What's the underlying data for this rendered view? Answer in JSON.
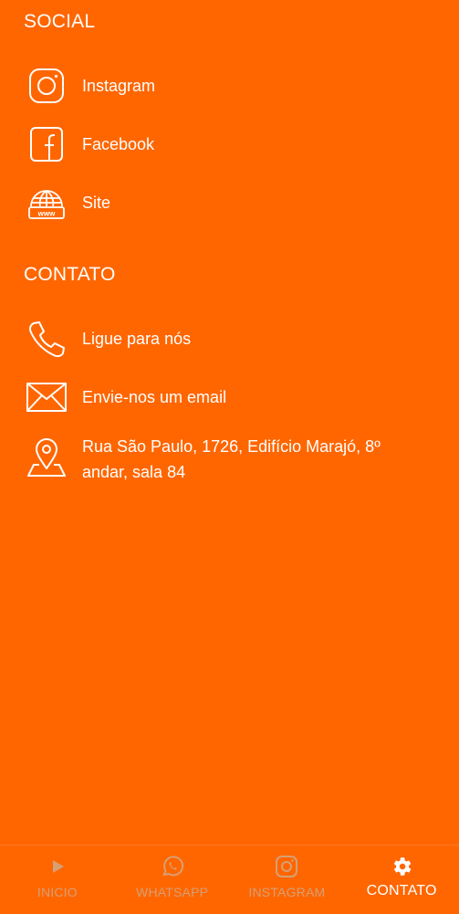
{
  "social": {
    "title": "SOCIAL",
    "items": [
      {
        "label": "Instagram",
        "icon": "instagram-icon"
      },
      {
        "label": "Facebook",
        "icon": "facebook-icon"
      },
      {
        "label": "Site",
        "icon": "globe-www-icon"
      }
    ]
  },
  "contato": {
    "title": "CONTATO",
    "items": [
      {
        "label": "Ligue para nós",
        "icon": "phone-icon"
      },
      {
        "label": "Envie-nos um email",
        "icon": "envelope-icon"
      },
      {
        "label": "Rua São Paulo, 1726, Edifício Marajó, 8º andar, sala 84",
        "icon": "map-pin-icon"
      }
    ]
  },
  "bottom_nav": {
    "items": [
      {
        "label": "INICIO",
        "icon": "play-icon",
        "active": false
      },
      {
        "label": "WHATSAPP",
        "icon": "whatsapp-icon",
        "active": false
      },
      {
        "label": "INSTAGRAM",
        "icon": "instagram-icon",
        "active": false
      },
      {
        "label": "CONTATO",
        "icon": "gear-icon",
        "active": true
      }
    ]
  },
  "colors": {
    "background": "#FF6600",
    "text": "#FFFFFF",
    "inactive_nav": "#C9B39C"
  }
}
